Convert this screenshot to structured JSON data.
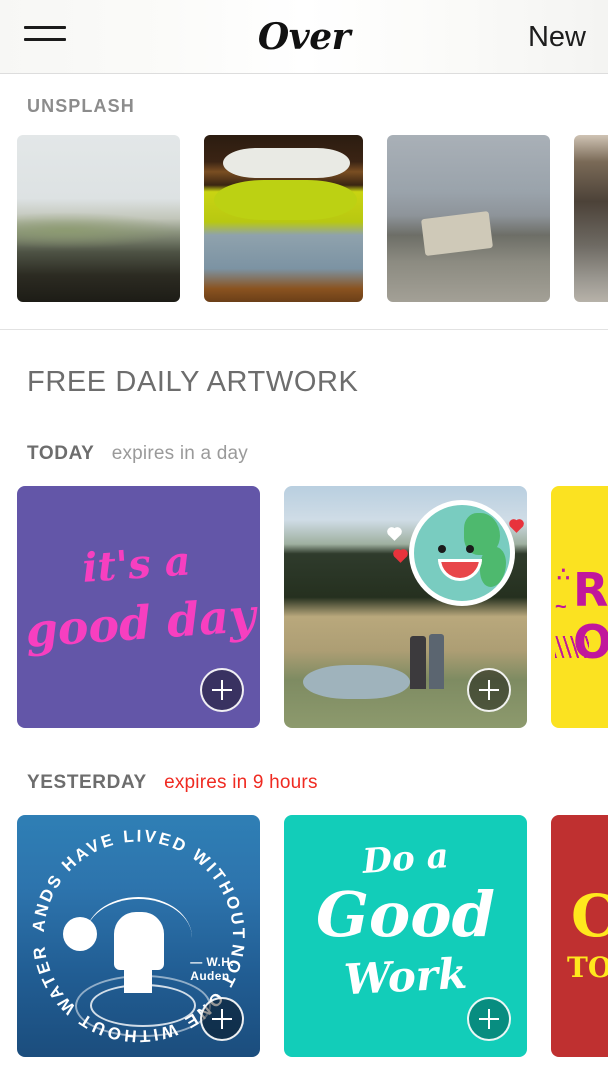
{
  "header": {
    "menu_icon": "hamburger-icon",
    "logo_text": "Over",
    "new_label": "New"
  },
  "unsplash": {
    "label": "UNSPLASH",
    "thumbnails": [
      {
        "alt": "misty forested hills"
      },
      {
        "alt": "stacked knit blankets and chartreuse scarf"
      },
      {
        "alt": "shipwreck on grey beach"
      },
      {
        "alt": "dark rocky coastal cliff"
      }
    ]
  },
  "daily": {
    "title": "FREE DAILY ARTWORK",
    "groups": [
      {
        "day": "TODAY",
        "expiry": "expires in a day",
        "urgent": false,
        "cards": [
          {
            "art": "goodday",
            "line1": "it's a",
            "line2": "good day",
            "bg_color": "#6356a8",
            "text_color": "#f73fc0",
            "add_label": "+"
          },
          {
            "art": "photo-earth-sticker",
            "alt": "three friends in a valley with smiling earth sticker",
            "add_label": "+"
          },
          {
            "art": "yellow-roar",
            "line1": "R",
            "line2": "O",
            "bg_color": "#fbe221",
            "text_color": "#c1179c"
          }
        ]
      },
      {
        "day": "YESTERDAY",
        "expiry": "expires in 9 hours",
        "urgent": true,
        "cards": [
          {
            "art": "water-auden",
            "ring_top": "THOUSANDS HAVE LIVED WITHOUT LOVE",
            "ring_bottom": "NOT ONE WITHOUT WATER",
            "credit_line1": "— W.H.",
            "credit_line2": "Auden",
            "bg_color": "#2d74ad",
            "add_label": "+"
          },
          {
            "art": "teal-do-good-work",
            "line1": "Do a",
            "line2": "Good",
            "line3": "Work",
            "bg_color": "#12cdb9",
            "text_color": "#ffffff",
            "add_label": "+"
          },
          {
            "art": "red-yellow",
            "line1": "C",
            "line2": "TO",
            "bg_color": "#bf3030",
            "text_color": "#ffe81d"
          }
        ]
      }
    ]
  }
}
